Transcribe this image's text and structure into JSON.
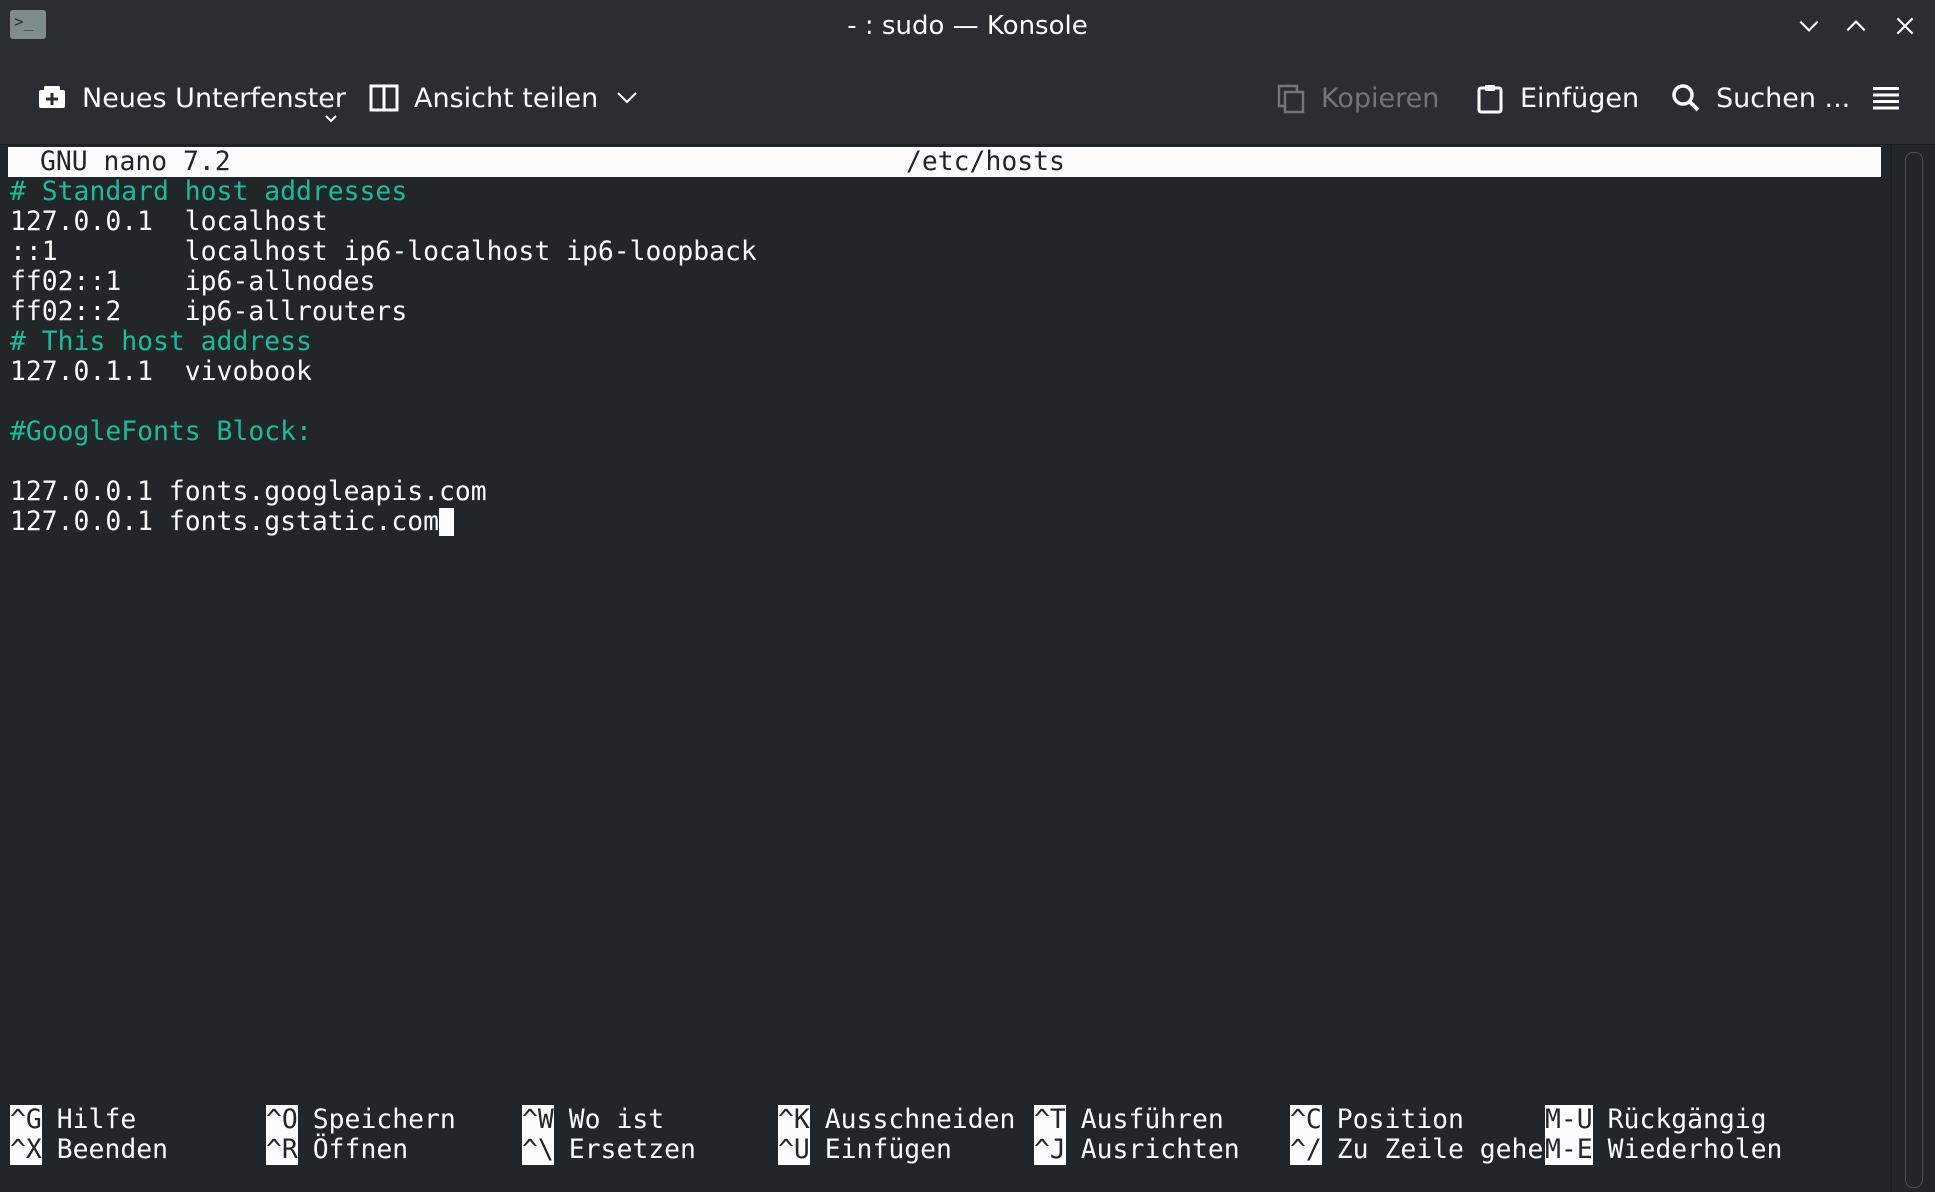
{
  "window": {
    "title": "- : sudo — Konsole",
    "app_icon_glyph": ">_"
  },
  "toolbar": {
    "new_tab": "Neues Unterfenster",
    "split_view": "Ansicht teilen",
    "copy": "Kopieren",
    "paste": "Einfügen",
    "search": "Suchen ..."
  },
  "nano": {
    "version": "GNU nano 7.2",
    "filename": "/etc/hosts"
  },
  "file_lines": [
    {
      "text": "# Standard host addresses",
      "comment": true
    },
    {
      "text": "127.0.0.1  localhost",
      "comment": false
    },
    {
      "text": "::1        localhost ip6-localhost ip6-loopback",
      "comment": false
    },
    {
      "text": "ff02::1    ip6-allnodes",
      "comment": false
    },
    {
      "text": "ff02::2    ip6-allrouters",
      "comment": false
    },
    {
      "text": "# This host address",
      "comment": true
    },
    {
      "text": "127.0.1.1  vivobook",
      "comment": false
    },
    {
      "text": "",
      "comment": false
    },
    {
      "text": "#GoogleFonts Block:",
      "comment": true
    },
    {
      "text": "",
      "comment": false
    },
    {
      "text": "127.0.0.1 fonts.googleapis.com",
      "comment": false
    },
    {
      "text": "127.0.0.1 fonts.gstatic.com",
      "comment": false
    }
  ],
  "shortcuts": [
    [
      {
        "key": "^G",
        "label": "Hilfe"
      },
      {
        "key": "^X",
        "label": "Beenden"
      }
    ],
    [
      {
        "key": "^O",
        "label": "Speichern"
      },
      {
        "key": "^R",
        "label": "Öffnen"
      }
    ],
    [
      {
        "key": "^W",
        "label": "Wo ist"
      },
      {
        "key": "^\\",
        "label": "Ersetzen"
      }
    ],
    [
      {
        "key": "^K",
        "label": "Ausschneiden"
      },
      {
        "key": "^U",
        "label": "Einfügen"
      }
    ],
    [
      {
        "key": "^T",
        "label": "Ausführen"
      },
      {
        "key": "^J",
        "label": "Ausrichten"
      }
    ],
    [
      {
        "key": "^C",
        "label": "Position"
      },
      {
        "key": "^/",
        "label": "Zu Zeile gehe"
      }
    ],
    [
      {
        "key": "M-U",
        "label": "Rückgängig"
      },
      {
        "key": "M-E",
        "label": "Wiederholen"
      }
    ]
  ],
  "colors": {
    "background": "#232629",
    "chrome": "#2a2e32",
    "foreground": "#fcfcfc",
    "comment": "#1abc9c",
    "disabled": "#727679"
  }
}
